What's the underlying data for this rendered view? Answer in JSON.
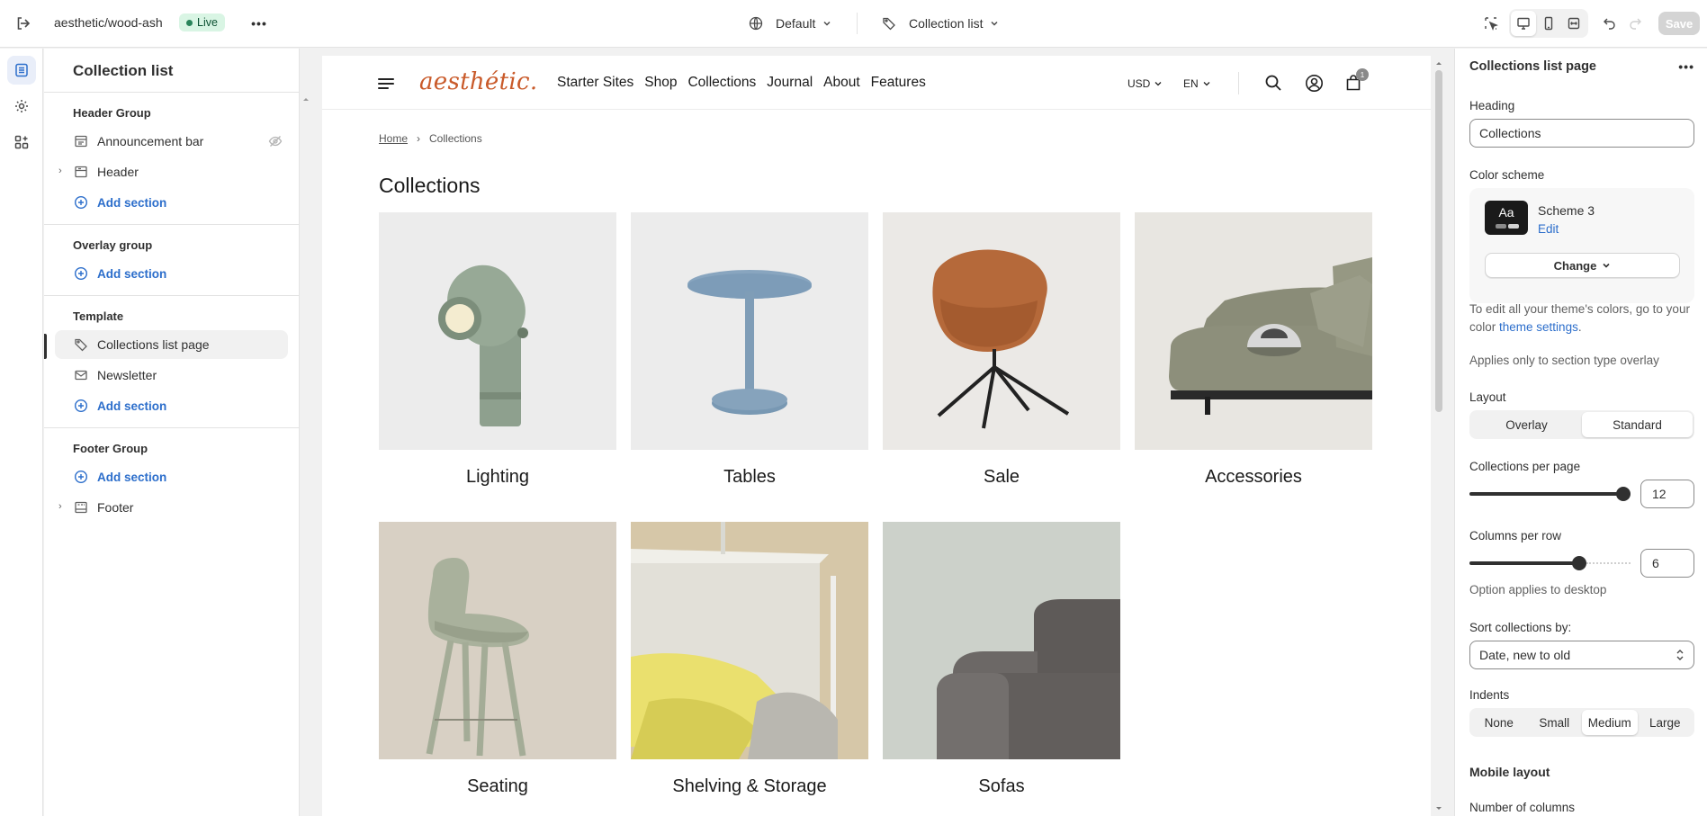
{
  "topbar": {
    "store_name": "aesthetic/wood-ash",
    "live_label": "Live",
    "theme_label": "Default",
    "page_label": "Collection list",
    "save_label": "Save"
  },
  "left": {
    "title": "Collection list",
    "groups": [
      {
        "title": "Header Group",
        "items": [
          {
            "label": "Announcement bar"
          },
          {
            "label": "Header"
          }
        ],
        "add": "Add section"
      },
      {
        "title": "Overlay group",
        "add": "Add section"
      },
      {
        "title": "Template",
        "items": [
          {
            "label": "Collections list page"
          },
          {
            "label": "Newsletter"
          }
        ],
        "add": "Add section"
      },
      {
        "title": "Footer Group",
        "items": [
          {
            "label": "Footer"
          }
        ],
        "add": "Add section"
      }
    ]
  },
  "preview": {
    "logo": "aesthétic.",
    "menu": [
      "Starter Sites",
      "Shop",
      "Collections",
      "Journal",
      "About",
      "Features"
    ],
    "currency": "USD",
    "language": "EN",
    "cart_count": "1",
    "breadcrumb": {
      "home": "Home",
      "current": "Collections"
    },
    "heading": "Collections",
    "collections": [
      "Lighting",
      "Tables",
      "Sale",
      "Accessories",
      "Seating",
      "Shelving & Storage",
      "Sofas"
    ]
  },
  "right": {
    "title": "Collections list page",
    "heading_label": "Heading",
    "heading_value": "Collections",
    "color_scheme_label": "Color scheme",
    "scheme_name": "Scheme 3",
    "scheme_edit": "Edit",
    "scheme_swatch": "Aa",
    "change_label": "Change",
    "help1_prefix": "To edit all your theme's colors, go to your color",
    "help1_link": "theme settings",
    "help1_suffix": ".",
    "help2": "Applies only to section type overlay",
    "layout_label": "Layout",
    "layout_options": [
      "Overlay",
      "Standard"
    ],
    "per_page_label": "Collections per page",
    "per_page_value": "12",
    "per_page_fraction": 1.0,
    "per_row_label": "Columns per row",
    "per_row_value": "6",
    "per_row_fraction": 0.7,
    "desktop_note": "Option applies to desktop",
    "sort_label": "Sort collections by:",
    "sort_value": "Date, new to old",
    "indents_label": "Indents",
    "indent_options": [
      "None",
      "Small",
      "Medium",
      "Large"
    ],
    "mobile_layout": "Mobile layout",
    "mobile_columns": "Number of columns"
  }
}
